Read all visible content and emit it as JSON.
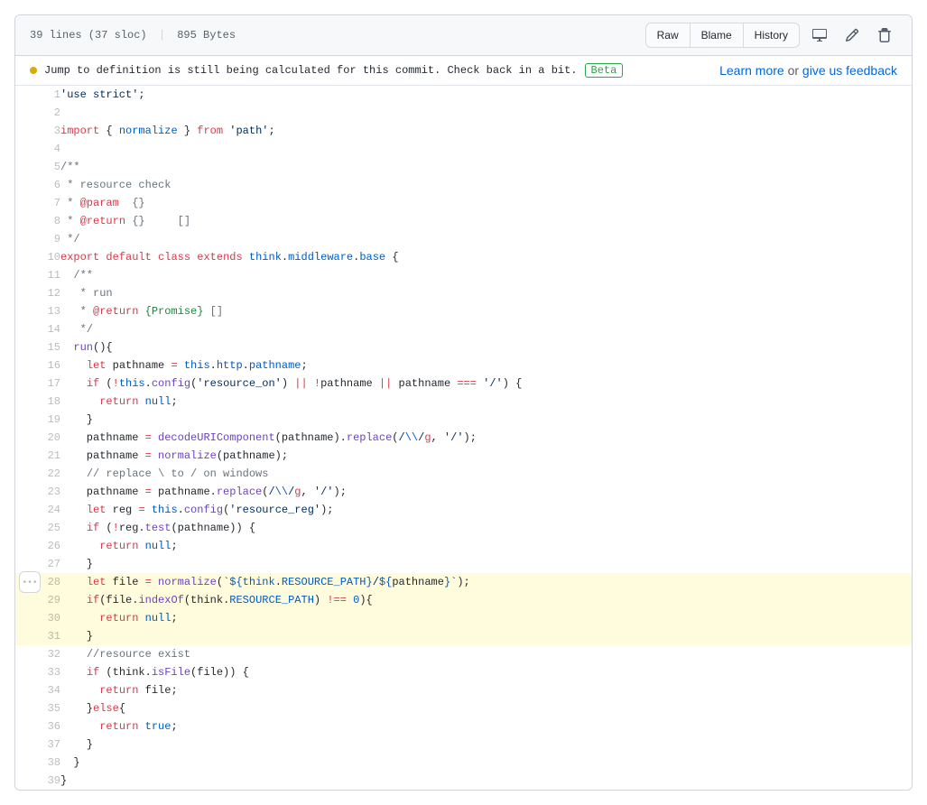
{
  "header": {
    "lines": "39 lines (37 sloc)",
    "size": "895 Bytes",
    "buttons": {
      "raw": "Raw",
      "blame": "Blame",
      "history": "History"
    }
  },
  "banner": {
    "message": "Jump to definition is still being calculated for this commit. Check back in a bit.",
    "badge": "Beta",
    "learn_more": "Learn more",
    "or": " or ",
    "feedback": "give us feedback"
  },
  "code": {
    "highlight_start": 28,
    "highlight_end": 31,
    "lines": [
      [
        {
          "t": "str",
          "v": "'use strict'"
        },
        {
          "t": "",
          "v": ";"
        }
      ],
      [],
      [
        {
          "t": "kw",
          "v": "import"
        },
        {
          "t": "",
          "v": " { "
        },
        {
          "t": "prop",
          "v": "normalize"
        },
        {
          "t": "",
          "v": " } "
        },
        {
          "t": "kw",
          "v": "from"
        },
        {
          "t": "",
          "v": " "
        },
        {
          "t": "str",
          "v": "'path'"
        },
        {
          "t": "",
          "v": ";"
        }
      ],
      [],
      [
        {
          "t": "cmt",
          "v": "/**"
        }
      ],
      [
        {
          "t": "cmt",
          "v": " * resource check"
        }
      ],
      [
        {
          "t": "cmt",
          "v": " * "
        },
        {
          "t": "kw",
          "v": "@param"
        },
        {
          "t": "cmt",
          "v": "  {}  "
        }
      ],
      [
        {
          "t": "cmt",
          "v": " * "
        },
        {
          "t": "kw",
          "v": "@return"
        },
        {
          "t": "cmt",
          "v": " {}     []"
        }
      ],
      [
        {
          "t": "cmt",
          "v": " */"
        }
      ],
      [
        {
          "t": "kw",
          "v": "export"
        },
        {
          "t": "",
          "v": " "
        },
        {
          "t": "kw",
          "v": "default"
        },
        {
          "t": "",
          "v": " "
        },
        {
          "t": "kw",
          "v": "class"
        },
        {
          "t": "",
          "v": " "
        },
        {
          "t": "kw",
          "v": "extends"
        },
        {
          "t": "",
          "v": " "
        },
        {
          "t": "prop",
          "v": "think"
        },
        {
          "t": "",
          "v": "."
        },
        {
          "t": "prop",
          "v": "middleware"
        },
        {
          "t": "",
          "v": "."
        },
        {
          "t": "prop",
          "v": "base"
        },
        {
          "t": "",
          "v": " {"
        }
      ],
      [
        {
          "t": "",
          "v": "  "
        },
        {
          "t": "cmt",
          "v": "/**"
        }
      ],
      [
        {
          "t": "",
          "v": "  "
        },
        {
          "t": "cmt",
          "v": " * run"
        }
      ],
      [
        {
          "t": "",
          "v": "  "
        },
        {
          "t": "cmt",
          "v": " * "
        },
        {
          "t": "kw",
          "v": "@return"
        },
        {
          "t": "cmt",
          "v": " "
        },
        {
          "t": "tag",
          "v": "{Promise}"
        },
        {
          "t": "cmt",
          "v": " []"
        }
      ],
      [
        {
          "t": "",
          "v": "  "
        },
        {
          "t": "cmt",
          "v": " */"
        }
      ],
      [
        {
          "t": "",
          "v": "  "
        },
        {
          "t": "fn",
          "v": "run"
        },
        {
          "t": "",
          "v": "(){"
        }
      ],
      [
        {
          "t": "",
          "v": "    "
        },
        {
          "t": "kw",
          "v": "let"
        },
        {
          "t": "",
          "v": " pathname "
        },
        {
          "t": "kw",
          "v": "="
        },
        {
          "t": "",
          "v": " "
        },
        {
          "t": "const",
          "v": "this"
        },
        {
          "t": "",
          "v": "."
        },
        {
          "t": "prop",
          "v": "http"
        },
        {
          "t": "",
          "v": "."
        },
        {
          "t": "prop",
          "v": "pathname"
        },
        {
          "t": "",
          "v": ";"
        }
      ],
      [
        {
          "t": "",
          "v": "    "
        },
        {
          "t": "kw",
          "v": "if"
        },
        {
          "t": "",
          "v": " ("
        },
        {
          "t": "kw",
          "v": "!"
        },
        {
          "t": "const",
          "v": "this"
        },
        {
          "t": "",
          "v": "."
        },
        {
          "t": "fn",
          "v": "config"
        },
        {
          "t": "",
          "v": "("
        },
        {
          "t": "str",
          "v": "'resource_on'"
        },
        {
          "t": "",
          "v": ") "
        },
        {
          "t": "kw",
          "v": "||"
        },
        {
          "t": "",
          "v": " "
        },
        {
          "t": "kw",
          "v": "!"
        },
        {
          "t": "",
          "v": "pathname "
        },
        {
          "t": "kw",
          "v": "||"
        },
        {
          "t": "",
          "v": " pathname "
        },
        {
          "t": "kw",
          "v": "==="
        },
        {
          "t": "",
          "v": " "
        },
        {
          "t": "str",
          "v": "'/'"
        },
        {
          "t": "",
          "v": ") {"
        }
      ],
      [
        {
          "t": "",
          "v": "      "
        },
        {
          "t": "kw",
          "v": "return"
        },
        {
          "t": "",
          "v": " "
        },
        {
          "t": "const",
          "v": "null"
        },
        {
          "t": "",
          "v": ";"
        }
      ],
      [
        {
          "t": "",
          "v": "    }"
        }
      ],
      [
        {
          "t": "",
          "v": "    pathname "
        },
        {
          "t": "kw",
          "v": "="
        },
        {
          "t": "",
          "v": " "
        },
        {
          "t": "fn",
          "v": "decodeURIComponent"
        },
        {
          "t": "",
          "v": "(pathname)."
        },
        {
          "t": "fn",
          "v": "replace"
        },
        {
          "t": "",
          "v": "("
        },
        {
          "t": "str",
          "v": "/"
        },
        {
          "t": "const",
          "v": "\\\\"
        },
        {
          "t": "str",
          "v": "/"
        },
        {
          "t": "kw",
          "v": "g"
        },
        {
          "t": "",
          "v": ", "
        },
        {
          "t": "str",
          "v": "'/'"
        },
        {
          "t": "",
          "v": ");"
        }
      ],
      [
        {
          "t": "",
          "v": "    pathname "
        },
        {
          "t": "kw",
          "v": "="
        },
        {
          "t": "",
          "v": " "
        },
        {
          "t": "fn",
          "v": "normalize"
        },
        {
          "t": "",
          "v": "(pathname);"
        }
      ],
      [
        {
          "t": "",
          "v": "    "
        },
        {
          "t": "cmt",
          "v": "// replace \\ to / on windows"
        }
      ],
      [
        {
          "t": "",
          "v": "    pathname "
        },
        {
          "t": "kw",
          "v": "="
        },
        {
          "t": "",
          "v": " pathname."
        },
        {
          "t": "fn",
          "v": "replace"
        },
        {
          "t": "",
          "v": "("
        },
        {
          "t": "str",
          "v": "/"
        },
        {
          "t": "const",
          "v": "\\\\"
        },
        {
          "t": "str",
          "v": "/"
        },
        {
          "t": "kw",
          "v": "g"
        },
        {
          "t": "",
          "v": ", "
        },
        {
          "t": "str",
          "v": "'/'"
        },
        {
          "t": "",
          "v": ");"
        }
      ],
      [
        {
          "t": "",
          "v": "    "
        },
        {
          "t": "kw",
          "v": "let"
        },
        {
          "t": "",
          "v": " reg "
        },
        {
          "t": "kw",
          "v": "="
        },
        {
          "t": "",
          "v": " "
        },
        {
          "t": "const",
          "v": "this"
        },
        {
          "t": "",
          "v": "."
        },
        {
          "t": "fn",
          "v": "config"
        },
        {
          "t": "",
          "v": "("
        },
        {
          "t": "str",
          "v": "'resource_reg'"
        },
        {
          "t": "",
          "v": ");"
        }
      ],
      [
        {
          "t": "",
          "v": "    "
        },
        {
          "t": "kw",
          "v": "if"
        },
        {
          "t": "",
          "v": " ("
        },
        {
          "t": "kw",
          "v": "!"
        },
        {
          "t": "",
          "v": "reg."
        },
        {
          "t": "fn",
          "v": "test"
        },
        {
          "t": "",
          "v": "(pathname)) {"
        }
      ],
      [
        {
          "t": "",
          "v": "      "
        },
        {
          "t": "kw",
          "v": "return"
        },
        {
          "t": "",
          "v": " "
        },
        {
          "t": "const",
          "v": "null"
        },
        {
          "t": "",
          "v": ";"
        }
      ],
      [
        {
          "t": "",
          "v": "    }"
        }
      ],
      [
        {
          "t": "",
          "v": "    "
        },
        {
          "t": "kw",
          "v": "let"
        },
        {
          "t": "",
          "v": " file "
        },
        {
          "t": "kw",
          "v": "="
        },
        {
          "t": "",
          "v": " "
        },
        {
          "t": "fn",
          "v": "normalize"
        },
        {
          "t": "",
          "v": "("
        },
        {
          "t": "str",
          "v": "`"
        },
        {
          "t": "const",
          "v": "${"
        },
        {
          "t": "prop",
          "v": "think"
        },
        {
          "t": "",
          "v": "."
        },
        {
          "t": "const",
          "v": "RESOURCE_PATH"
        },
        {
          "t": "const",
          "v": "}"
        },
        {
          "t": "str",
          "v": "/"
        },
        {
          "t": "const",
          "v": "${"
        },
        {
          "t": "",
          "v": "pathname"
        },
        {
          "t": "const",
          "v": "}"
        },
        {
          "t": "str",
          "v": "`"
        },
        {
          "t": "",
          "v": ");"
        }
      ],
      [
        {
          "t": "",
          "v": "    "
        },
        {
          "t": "kw",
          "v": "if"
        },
        {
          "t": "",
          "v": "(file."
        },
        {
          "t": "fn",
          "v": "indexOf"
        },
        {
          "t": "",
          "v": "(think."
        },
        {
          "t": "const",
          "v": "RESOURCE_PATH"
        },
        {
          "t": "",
          "v": ") "
        },
        {
          "t": "kw",
          "v": "!=="
        },
        {
          "t": "",
          "v": " "
        },
        {
          "t": "const",
          "v": "0"
        },
        {
          "t": "",
          "v": "){"
        }
      ],
      [
        {
          "t": "",
          "v": "      "
        },
        {
          "t": "kw",
          "v": "return"
        },
        {
          "t": "",
          "v": " "
        },
        {
          "t": "const",
          "v": "null"
        },
        {
          "t": "",
          "v": ";"
        }
      ],
      [
        {
          "t": "",
          "v": "    }"
        }
      ],
      [
        {
          "t": "",
          "v": "    "
        },
        {
          "t": "cmt",
          "v": "//resource exist"
        }
      ],
      [
        {
          "t": "",
          "v": "    "
        },
        {
          "t": "kw",
          "v": "if"
        },
        {
          "t": "",
          "v": " (think."
        },
        {
          "t": "fn",
          "v": "isFile"
        },
        {
          "t": "",
          "v": "(file)) {"
        }
      ],
      [
        {
          "t": "",
          "v": "      "
        },
        {
          "t": "kw",
          "v": "return"
        },
        {
          "t": "",
          "v": " file;"
        }
      ],
      [
        {
          "t": "",
          "v": "    }"
        },
        {
          "t": "kw",
          "v": "else"
        },
        {
          "t": "",
          "v": "{"
        }
      ],
      [
        {
          "t": "",
          "v": "      "
        },
        {
          "t": "kw",
          "v": "return"
        },
        {
          "t": "",
          "v": " "
        },
        {
          "t": "const",
          "v": "true"
        },
        {
          "t": "",
          "v": ";"
        }
      ],
      [
        {
          "t": "",
          "v": "    }"
        }
      ],
      [
        {
          "t": "",
          "v": "  }"
        }
      ],
      [
        {
          "t": "",
          "v": "}"
        }
      ]
    ]
  }
}
